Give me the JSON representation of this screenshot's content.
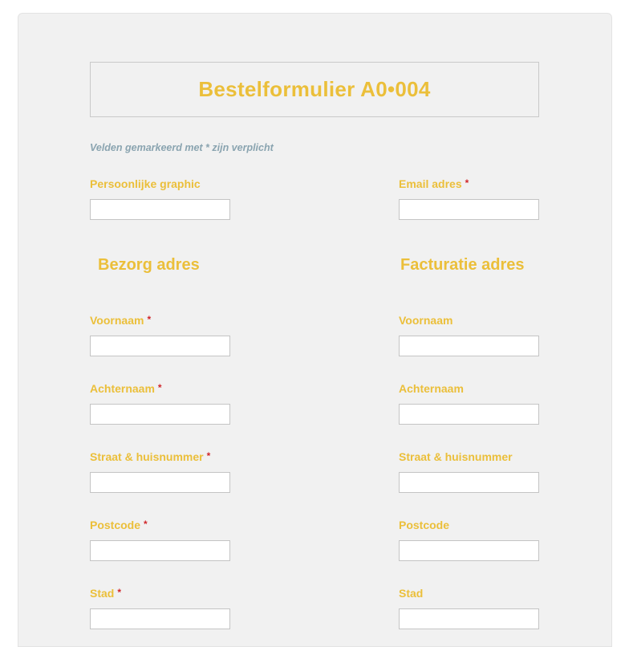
{
  "form": {
    "title": "Bestelformulier A0•004",
    "required_note": "Velden gemarkeerd met * zijn verplicht",
    "required_marker": "*"
  },
  "top_fields": {
    "graphic_label": "Persoonlijke graphic",
    "email_label": "Email adres"
  },
  "shipping": {
    "heading": "Bezorg adres",
    "first_name_label": "Voornaam",
    "last_name_label": "Achternaam",
    "street_label": "Straat & huisnummer",
    "postcode_label": "Postcode",
    "city_label": "Stad"
  },
  "billing": {
    "heading": "Facturatie adres",
    "first_name_label": "Voornaam",
    "last_name_label": "Achternaam",
    "street_label": "Straat & huisnummer",
    "postcode_label": "Postcode",
    "city_label": "Stad"
  },
  "colors": {
    "accent": "#ebbf3a",
    "required": "#d0262a",
    "note": "#8aa4b0",
    "panel_background": "#f1f1f1"
  }
}
